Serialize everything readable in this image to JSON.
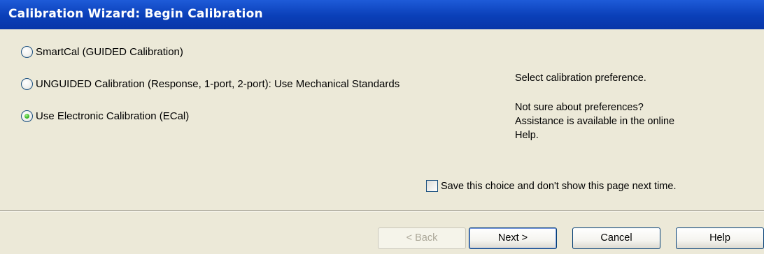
{
  "title_bar": {
    "title": "Calibration Wizard: Begin Calibration"
  },
  "options": [
    {
      "label": "SmartCal (GUIDED Calibration)",
      "selected": false
    },
    {
      "label": "UNGUIDED Calibration (Response, 1-port, 2-port): Use Mechanical Standards",
      "selected": false
    },
    {
      "label": "Use Electronic Calibration (ECal)",
      "selected": true
    }
  ],
  "help": {
    "instruction": "Select calibration preference.",
    "line1": "Not sure about preferences?",
    "line2": "Assistance is available in the online",
    "line3": "Help."
  },
  "save_choice": {
    "label": "Save this choice and don't show this page next time.",
    "checked": false
  },
  "buttons": {
    "back": "< Back",
    "next": "Next >",
    "cancel": "Cancel",
    "help": "Help"
  },
  "colors": {
    "title_bar": "#0A3FB8",
    "dialog_background": "#ECE9D8",
    "radio_selected": "#3DBA2A"
  }
}
